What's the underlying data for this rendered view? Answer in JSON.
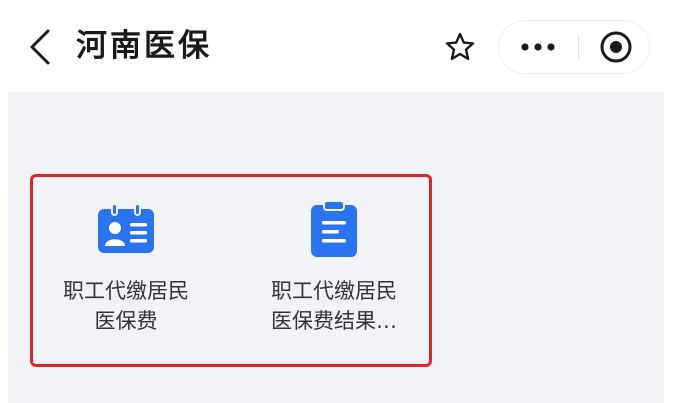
{
  "nav": {
    "title": "河南医保",
    "back_icon": "chevron-left-icon",
    "star_icon": "star-outline-icon",
    "more_icon": "more-dots-icon",
    "close_icon": "target-circle-icon"
  },
  "colors": {
    "title": "#1a1a1a",
    "content_background": "#f1f3f7",
    "icon_blue": "#2b74f0",
    "highlight_red": "#e02427",
    "label_text": "#333333"
  },
  "services": [
    {
      "label_line1": "职工代缴居民",
      "label_line2": "医保费",
      "icon": "id-card-icon"
    },
    {
      "label_line1": "职工代缴居民",
      "label_line2": "医保费结果…",
      "icon": "clipboard-document-icon"
    }
  ]
}
